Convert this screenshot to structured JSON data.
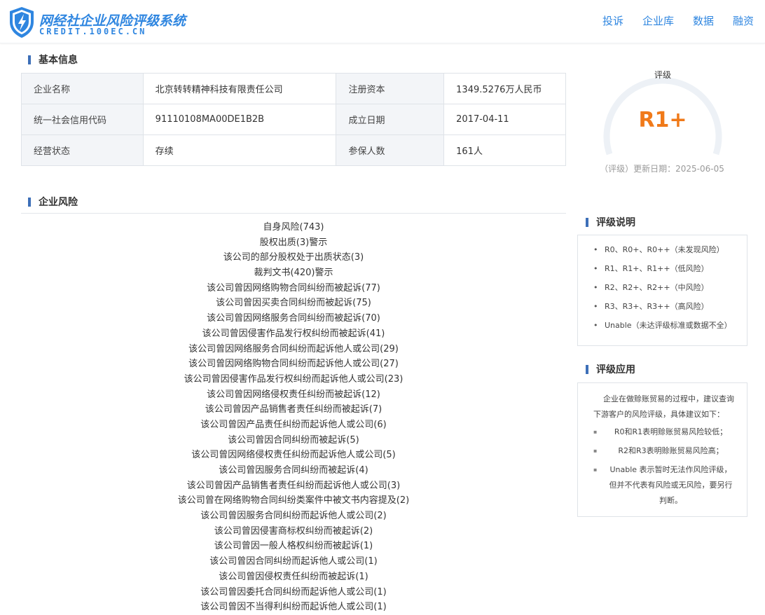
{
  "header": {
    "logo_title": "网经社企业风险评级系统",
    "logo_subtitle": "CREDIT.100EC.CN",
    "nav": [
      "投诉",
      "企业库",
      "数据",
      "融资"
    ]
  },
  "basic_info": {
    "section_title": "基本信息",
    "rows": [
      {
        "label1": "企业名称",
        "value1": "北京转转精神科技有限责任公司",
        "label2": "注册资本",
        "value2": "1349.5276万人民币"
      },
      {
        "label1": "统一社会信用代码",
        "value1": "91110108MA00DE1B2B",
        "label2": "成立日期",
        "value2": "2017-04-11"
      },
      {
        "label1": "经营状态",
        "value1": "存续",
        "label2": "参保人数",
        "value2": "161人"
      }
    ]
  },
  "rating": {
    "label": "评级",
    "value": "R1+",
    "update_text": "（评级）更新日期：2025-06-05",
    "accent_color": "#f07a1a"
  },
  "risk": {
    "section_title": "企业风险",
    "items": [
      "自身风险(743)",
      "股权出质(3)警示",
      "该公司的部分股权处于出质状态(3)",
      "裁判文书(420)警示",
      "该公司曾因网络购物合同纠纷而被起诉(77)",
      "该公司曾因买卖合同纠纷而被起诉(75)",
      "该公司曾因网络服务合同纠纷而被起诉(70)",
      "该公司曾因侵害作品发行权纠纷而被起诉(41)",
      "该公司曾因网络服务合同纠纷而起诉他人或公司(29)",
      "该公司曾因网络购物合同纠纷而起诉他人或公司(27)",
      "该公司曾因侵害作品发行权纠纷而起诉他人或公司(23)",
      "该公司曾因网络侵权责任纠纷而被起诉(12)",
      "该公司曾因产品销售者责任纠纷而被起诉(7)",
      "该公司曾因产品责任纠纷而起诉他人或公司(6)",
      "该公司曾因合同纠纷而被起诉(5)",
      "该公司曾因网络侵权责任纠纷而起诉他人或公司(5)",
      "该公司曾因服务合同纠纷而被起诉(4)",
      "该公司曾因产品销售者责任纠纷而起诉他人或公司(3)",
      "该公司曾在网络购物合同纠纷类案件中被文书内容提及(2)",
      "该公司曾因服务合同纠纷而起诉他人或公司(2)",
      "该公司曾因侵害商标权纠纷而被起诉(2)",
      "该公司曾因一般人格权纠纷而被起诉(1)",
      "该公司曾因合同纠纷而起诉他人或公司(1)",
      "该公司曾因侵权责任纠纷而被起诉(1)",
      "该公司曾因委托合同纠纷而起诉他人或公司(1)",
      "该公司曾因不当得利纠纷而起诉他人或公司(1)"
    ]
  },
  "rating_legend": {
    "section_title": "评级说明",
    "items": [
      "R0、R0+、R0++（未发现风险）",
      "R1、R1+、R1++（低风险）",
      "R2、R2+、R2++（中风险）",
      "R3、R3+、R3++（高风险）",
      "Unable（未达评级标准或数据不全）"
    ]
  },
  "rating_application": {
    "section_title": "评级应用",
    "intro": "企业在做赊账贸易的过程中，建议查询下游客户的风险评级，具体建议如下：",
    "items": [
      "R0和R1表明赊账贸易风险较低；",
      "R2和R3表明赊账贸易风险高；",
      "Unable 表示暂时无法作风险评级，但并不代表有风险或无风险，要另行判断。"
    ]
  }
}
